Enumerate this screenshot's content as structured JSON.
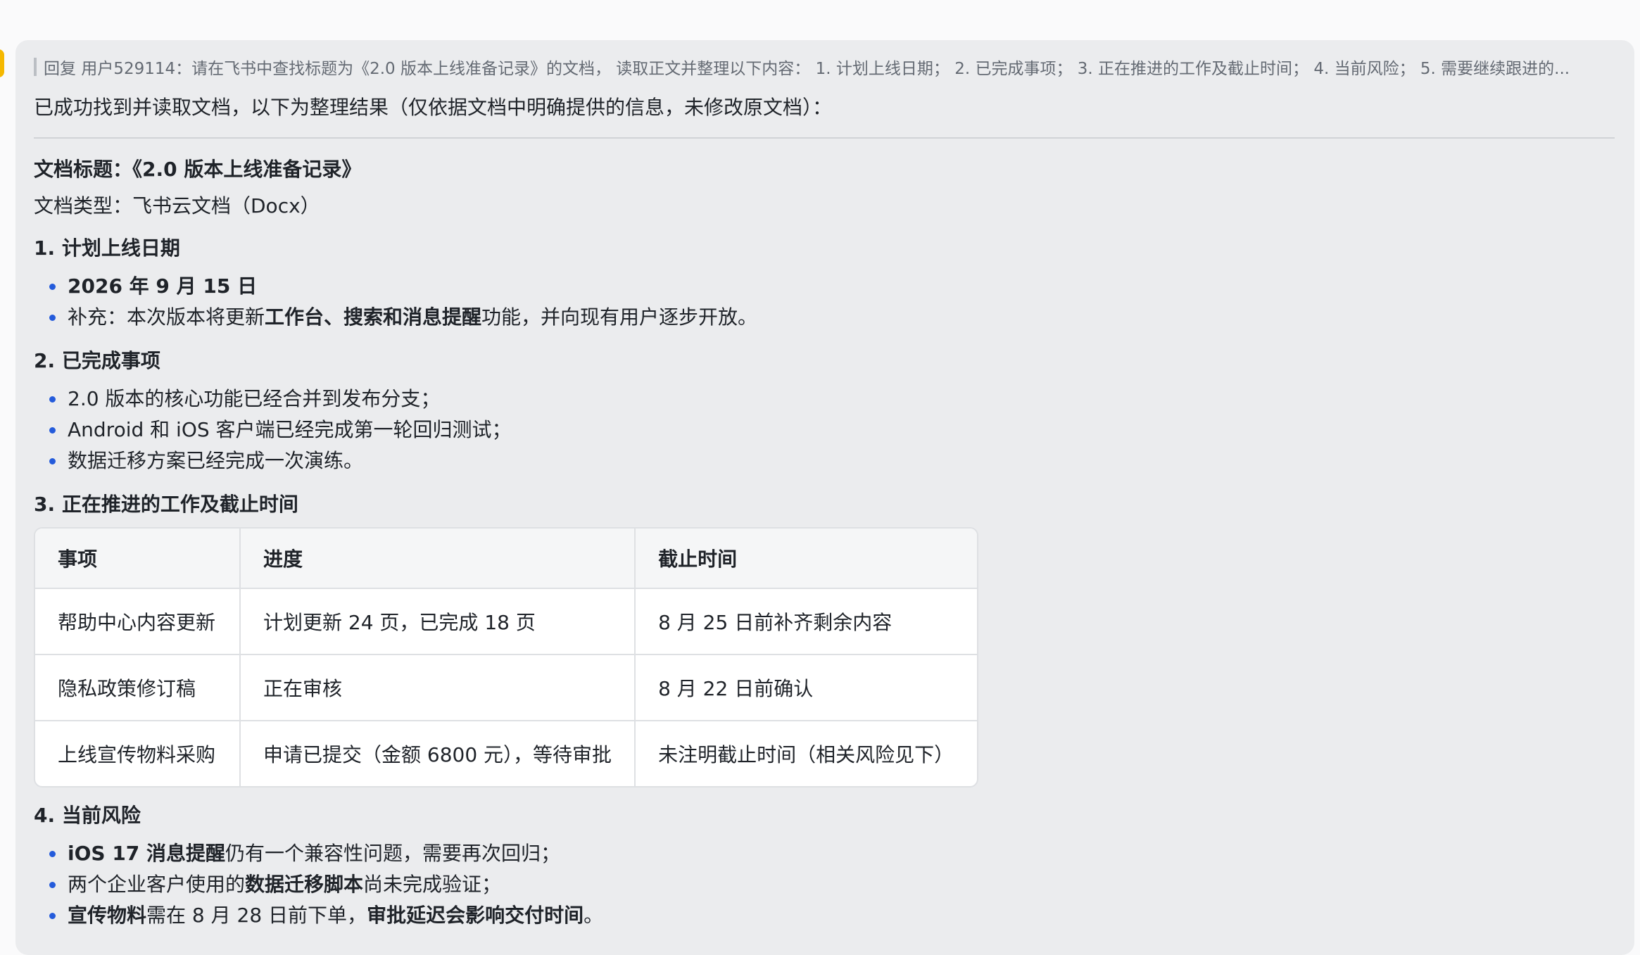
{
  "quote": {
    "text": "回复 用户529114：请在飞书中查找标题为《2.0 版本上线准备记录》的文档， 读取正文并整理以下内容： 1. 计划上线日期； 2. 已完成事项； 3. 正在推进的工作及截止时间； 4. 当前风险； 5. 需要继续跟进的..."
  },
  "message": {
    "intro": "已成功找到并读取文档，以下为整理结果（仅依据文档中明确提供的信息，未修改原文档）：",
    "doc_title": "文档标题：《2.0 版本上线准备记录》",
    "doc_type": "文档类型：飞书云文档（Docx）",
    "section1": {
      "heading": "1. 计划上线日期",
      "date": "2026 年 9 月 15 日",
      "note_prefix": "补充：本次版本将更新",
      "note_bold": "工作台、搜索和消息提醒",
      "note_suffix": "功能，并向现有用户逐步开放。"
    },
    "section2": {
      "heading": "2. 已完成事项",
      "items": [
        "2.0 版本的核心功能已经合并到发布分支；",
        "Android 和 iOS 客户端已经完成第一轮回归测试；",
        "数据迁移方案已经完成一次演练。"
      ]
    },
    "section3": {
      "heading": "3. 正在推进的工作及截止时间",
      "columns": [
        "事项",
        "进度",
        "截止时间"
      ],
      "rows": [
        [
          "帮助中心内容更新",
          "计划更新 24 页，已完成 18 页",
          "8 月 25 日前补齐剩余内容"
        ],
        [
          "隐私政策修订稿",
          "正在审核",
          "8 月 22 日前确认"
        ],
        [
          "上线宣传物料采购",
          "申请已提交（金额 6800 元），等待审批",
          "未注明截止时间（相关风险见下）"
        ]
      ]
    },
    "section4": {
      "heading": "4. 当前风险",
      "r1_bold": "iOS 17 消息提醒",
      "r1_rest": "仍有一个兼容性问题，需要再次回归；",
      "r2_pre": "两个企业客户使用的",
      "r2_bold": "数据迁移脚本",
      "r2_post": "尚未完成验证；",
      "r3_bold1": "宣传物料",
      "r3_mid": "需在 8 月 28 日前下单，",
      "r3_bold2": "审批延迟会影响交付时间",
      "r3_end": "。"
    }
  },
  "colors": {
    "bubble_bg": "#ebecee",
    "bullet": "#245bdb",
    "marker": "#f5b800"
  }
}
